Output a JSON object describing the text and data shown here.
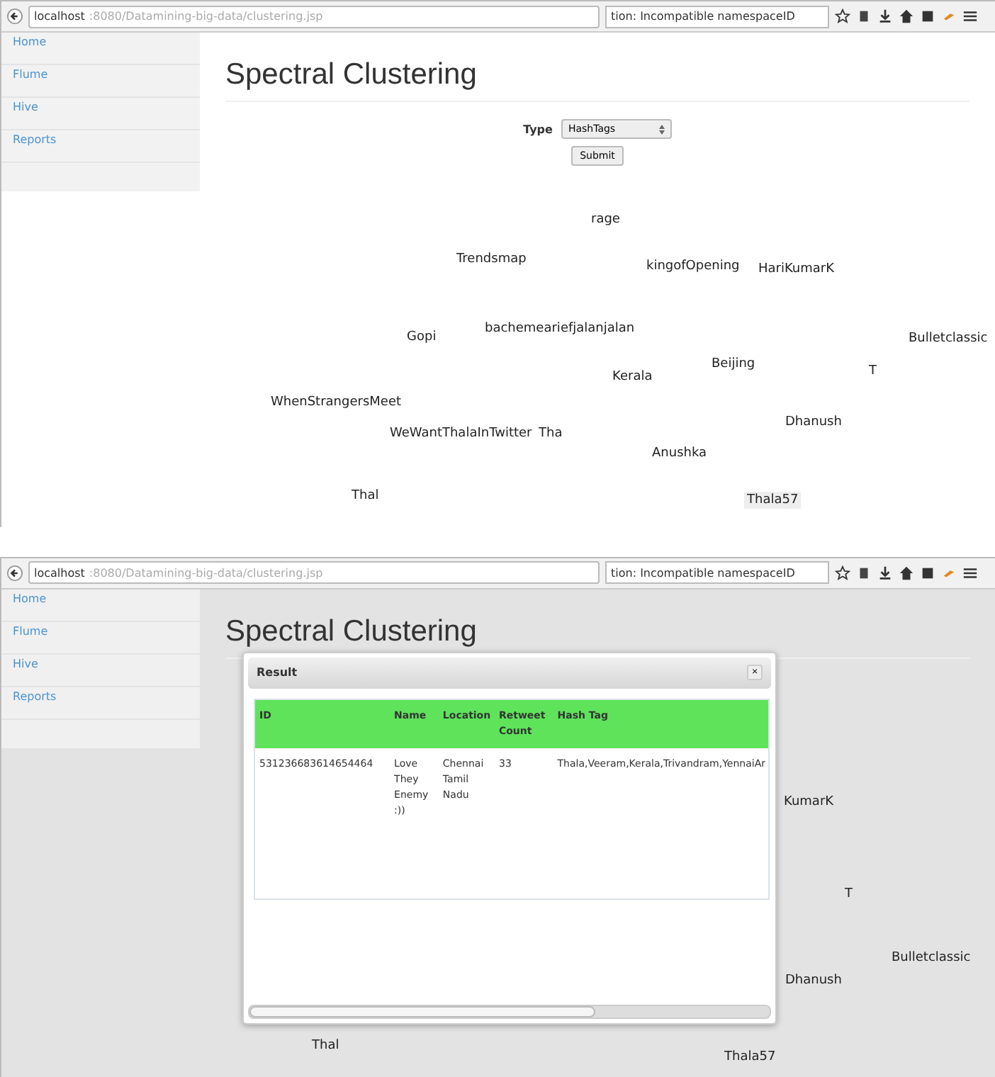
{
  "screenshots": [
    {
      "browser": {
        "url_host": "localhost",
        "url_path": ":8080/Datamining-big-data/clustering.jsp",
        "search_text": "tion: Incompatible namespaceID"
      },
      "sidebar": [
        {
          "label": "Home"
        },
        {
          "label": "Flume"
        },
        {
          "label": "Hive"
        },
        {
          "label": "Reports"
        }
      ],
      "heading": "Spectral Clustering",
      "form": {
        "type_label": "Type",
        "type_value": "HashTags",
        "submit": "Submit"
      },
      "cloud": [
        {
          "text": "rage",
          "highlighted": false
        },
        {
          "text": "Trendsmap",
          "highlighted": false
        },
        {
          "text": "kingofOpening",
          "highlighted": false
        },
        {
          "text": "HariKumarK",
          "highlighted": false
        },
        {
          "text": "Gopi",
          "highlighted": false
        },
        {
          "text": "bachemeariefjalanjalan",
          "highlighted": false
        },
        {
          "text": "Bulletclassic",
          "highlighted": false
        },
        {
          "text": "Beijing",
          "highlighted": false
        },
        {
          "text": "Kerala",
          "highlighted": false
        },
        {
          "text": "T",
          "highlighted": false
        },
        {
          "text": "WhenStrangersMeet",
          "highlighted": false
        },
        {
          "text": "Dhanush",
          "highlighted": false
        },
        {
          "text": "WeWantThalaInTwitter",
          "highlighted": false
        },
        {
          "text": "Tha",
          "highlighted": false
        },
        {
          "text": "Anushka",
          "highlighted": false
        },
        {
          "text": "Thal",
          "highlighted": false
        },
        {
          "text": "Thala57",
          "highlighted": true
        }
      ]
    },
    {
      "browser": {
        "url_host": "localhost",
        "url_path": ":8080/Datamining-big-data/clustering.jsp",
        "search_text": "tion: Incompatible namespaceID"
      },
      "sidebar": [
        {
          "label": "Home"
        },
        {
          "label": "Flume"
        },
        {
          "label": "Hive"
        },
        {
          "label": "Reports"
        }
      ],
      "heading": "Spectral Clustering",
      "cloud": [
        {
          "text": "KumarK",
          "highlighted": false
        },
        {
          "text": "T",
          "highlighted": false
        },
        {
          "text": "Bulletclassic",
          "highlighted": false
        },
        {
          "text": "Dhanush",
          "highlighted": false
        },
        {
          "text": "Thal",
          "highlighted": false
        },
        {
          "text": "Thala57",
          "highlighted": false
        }
      ],
      "dialog": {
        "title": "Result",
        "close": "×",
        "table": {
          "columns": [
            "ID",
            "Name",
            "Location",
            "Retweet Count",
            "Hash Tag"
          ],
          "rows": [
            [
              "531236683614654464",
              "Love They Enemy :))",
              "Chennai Tamil Nadu",
              "33",
              "Thala,Veeram,Kerala,Trivandram,YennaiAr"
            ]
          ]
        }
      }
    }
  ]
}
